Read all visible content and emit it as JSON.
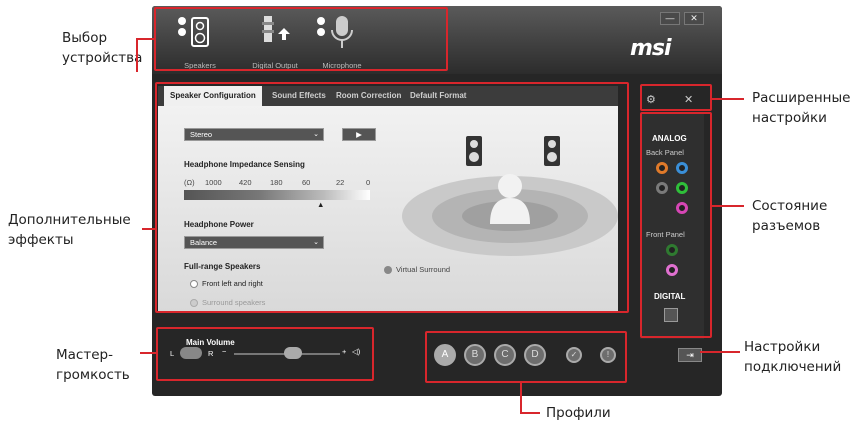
{
  "annotations": {
    "device_select": "Выбор\nустройства",
    "advanced_settings": "Расширенные\nнастройки",
    "extra_effects": "Дополнительные\nэффекты",
    "jack_status": "Состояние\nразъемов",
    "master_volume": "Мастер-\nгромкость",
    "connection_settings": "Настройки\nподключений",
    "profiles": "Профили"
  },
  "app": {
    "logo": "msi",
    "window": {
      "minimize": "—",
      "close": "✕"
    },
    "devices": [
      {
        "label": "Speakers",
        "icon": "speaker-icon"
      },
      {
        "label": "Digital Output",
        "icon": "digital-output-icon"
      },
      {
        "label": "Microphone",
        "icon": "microphone-icon"
      }
    ],
    "tabs": [
      "Speaker Configuration",
      "Sound Effects",
      "Room Correction",
      "Default Format"
    ],
    "speaker_config": {
      "mode": "Stereo",
      "play_icon": "▶",
      "impedance_title": "Headphone Impedance Sensing",
      "impedance_unit": "(Ω)",
      "impedance_values": [
        "1000",
        "420",
        "180",
        "60",
        "22",
        "0"
      ],
      "power_title": "Headphone Power",
      "power_value": "Balance",
      "fullrange_title": "Full-range Speakers",
      "fullrange_opt1": "Front left and right",
      "fullrange_opt2": "Surround speakers",
      "virtual_surround": "Virtual Surround"
    },
    "volume": {
      "title": "Main Volume",
      "left": "L",
      "right": "R",
      "minus": "−",
      "plus": "+"
    },
    "profiles": [
      "A",
      "B",
      "C",
      "D"
    ],
    "jacks": {
      "analog_title": "ANALOG",
      "back_panel": "Back Panel",
      "front_panel": "Front Panel",
      "digital_title": "DIGITAL",
      "colors": {
        "orange": "#e07a2a",
        "blue": "#3a8fd8",
        "grey": "#7a7a7a",
        "green": "#2fbf3a",
        "pink": "#d646b5"
      }
    }
  }
}
